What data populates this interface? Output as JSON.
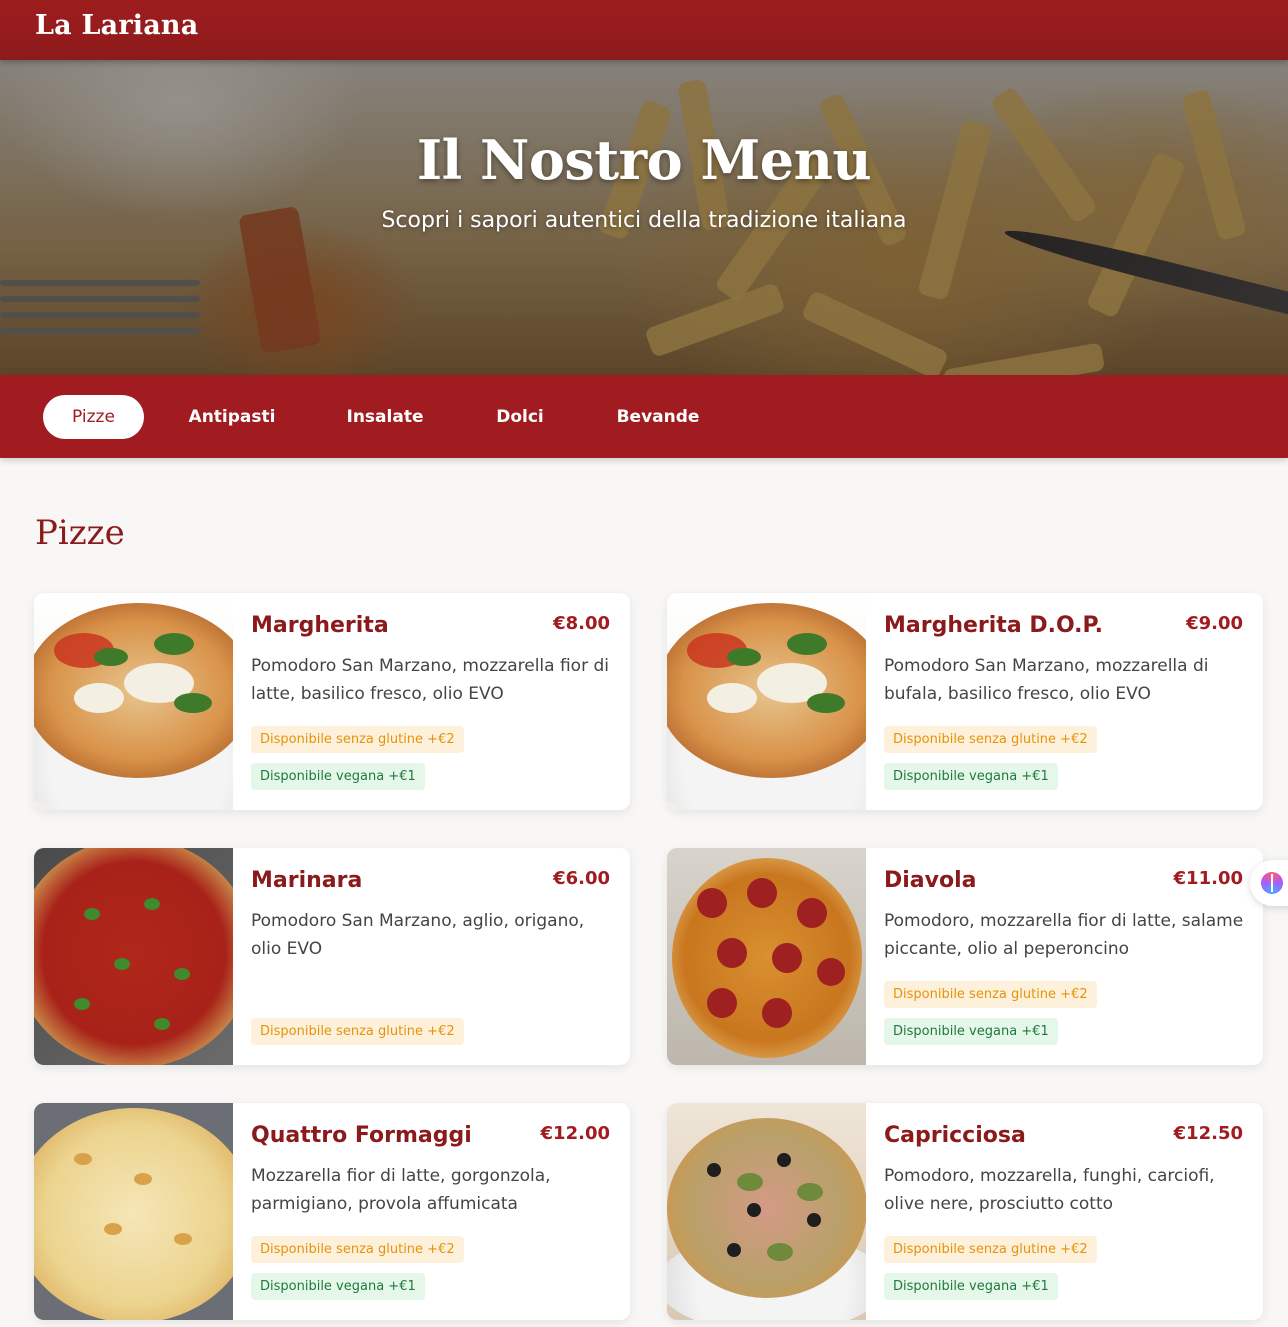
{
  "brand": "La Lariana",
  "hero": {
    "title": "Il Nostro Menu",
    "subtitle": "Scopri i sapori autentici della tradizione italiana"
  },
  "categories": [
    {
      "label": "Pizze",
      "active": true
    },
    {
      "label": "Antipasti",
      "active": false
    },
    {
      "label": "Insalate",
      "active": false
    },
    {
      "label": "Dolci",
      "active": false
    },
    {
      "label": "Bevande",
      "active": false
    }
  ],
  "section_title": "Pizze",
  "items": [
    {
      "name": "Margherita",
      "price": "€8.00",
      "description": "Pomodoro San Marzano, mozzarella fior di latte, basilico fresco, olio EVO",
      "gluten_free": "Disponibile senza glutine +€2",
      "vegan": "Disponibile vegana +€1"
    },
    {
      "name": "Margherita D.O.P.",
      "price": "€9.00",
      "description": "Pomodoro San Marzano, mozzarella di bufala, basilico fresco, olio EVO",
      "gluten_free": "Disponibile senza glutine +€2",
      "vegan": "Disponibile vegana +€1"
    },
    {
      "name": "Marinara",
      "price": "€6.00",
      "description": "Pomodoro San Marzano, aglio, origano, olio EVO",
      "gluten_free": "Disponibile senza glutine +€2"
    },
    {
      "name": "Diavola",
      "price": "€11.00",
      "description": "Pomodoro, mozzarella fior di latte, salame piccante, olio al peperoncino",
      "gluten_free": "Disponibile senza glutine +€2",
      "vegan": "Disponibile vegana +€1"
    },
    {
      "name": "Quattro Formaggi",
      "price": "€12.00",
      "description": "Mozzarella fior di latte, gorgonzola, parmigiano, provola affumicata",
      "gluten_free": "Disponibile senza glutine +€2",
      "vegan": "Disponibile vegana +€1"
    },
    {
      "name": "Capricciosa",
      "price": "€12.50",
      "description": "Pomodoro, mozzarella, funghi, carciofi, olive nere, prosciutto cotto",
      "gluten_free": "Disponibile senza glutine +€2",
      "vegan": "Disponibile vegana +€1"
    }
  ],
  "colors": {
    "brand_red": "#a11c20",
    "title_red": "#8b1a1c",
    "gluten_badge_bg": "#fdf1dc",
    "gluten_badge_text": "#e8920a",
    "vegan_badge_bg": "#e4f7e9",
    "vegan_badge_text": "#1e7a3b"
  },
  "icons": {
    "side_widget": "assistant-brain-icon"
  }
}
